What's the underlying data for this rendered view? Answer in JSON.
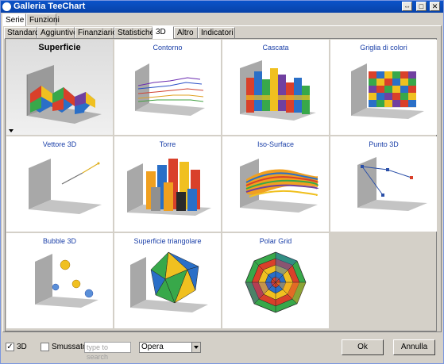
{
  "window": {
    "title": "Galleria TeeChart"
  },
  "top_tabs": [
    "Serie",
    "Funzioni"
  ],
  "sub_tabs": [
    "Standard",
    "Aggiuntive",
    "Finanziario",
    "Statistiche",
    "3D",
    "Altro",
    "Indicatori"
  ],
  "gallery": {
    "items": [
      {
        "label": "Superficie"
      },
      {
        "label": "Contorno"
      },
      {
        "label": "Cascata"
      },
      {
        "label": "Griglia di colori"
      },
      {
        "label": "Vettore 3D"
      },
      {
        "label": "Torre"
      },
      {
        "label": "Iso-Surface"
      },
      {
        "label": "Punto 3D"
      },
      {
        "label": "Bubble 3D"
      },
      {
        "label": "Superficie triangolare"
      },
      {
        "label": "Polar Grid"
      }
    ]
  },
  "bottom": {
    "check_3d_label": "3D",
    "check_3d_mark": "✓",
    "check_smooth_label": "Smussato",
    "search_placeholder": "type to search",
    "theme_value": "Opera",
    "ok_label": "Ok",
    "cancel_label": "Annulla"
  }
}
